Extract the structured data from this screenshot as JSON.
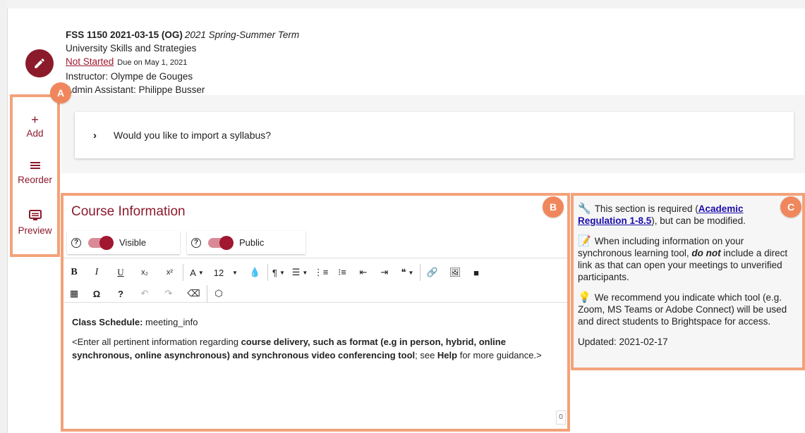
{
  "header": {
    "course_code": "FSS 1150 2021-03-15 (OG)",
    "term": "2021 Spring-Summer Term",
    "course_name": "University Skills and Strategies",
    "status": "Not Started",
    "due": "Due on May 1, 2021",
    "instructor": "Instructor: Olympe de Gouges",
    "admin": "Admin Assistant: Philippe Busser",
    "edit_icon": "pencil-icon"
  },
  "rail": {
    "add_label": "Add",
    "reorder_label": "Reorder",
    "preview_label": "Preview"
  },
  "callouts": {
    "a": "A",
    "b": "B",
    "c": "C"
  },
  "import_card": {
    "text": "Would you like to import a syllabus?"
  },
  "course_info": {
    "title": "Course Information",
    "visible_label": "Visible",
    "public_label": "Public",
    "visible_on": true,
    "public_on": true,
    "font_size": "12",
    "char_count": "0",
    "content": {
      "schedule_label": "Class Schedule:",
      "schedule_value": " meeting_info",
      "p2_a": "<Enter all pertinent information regarding ",
      "p2_b": "course delivery, such as format (e.g in person, hybrid, online synchronous, online asynchronous) and synchronous video conferencing tool",
      "p2_c": "; see ",
      "p2_d": "Help",
      "p2_e": " for more guidance.>"
    }
  },
  "help_panel": {
    "required_a": "This section is required (",
    "required_link": "Academic Regulation 1-8.5",
    "required_b": "), but can be modified.",
    "sync_a": "When including information on your synchronous learning tool, ",
    "sync_em": "do not",
    "sync_b": " include a direct link as that can open your meetings to unverified participants.",
    "recommend": "We recommend you indicate which tool (e.g. Zoom, MS Teams or Adobe Connect) will be used and direct students to Brightspace for access.",
    "updated": "Updated: 2021-02-17"
  },
  "colors": {
    "brand": "#8b1a2b",
    "callout": "#f0875c",
    "link": "#1a0dab"
  }
}
